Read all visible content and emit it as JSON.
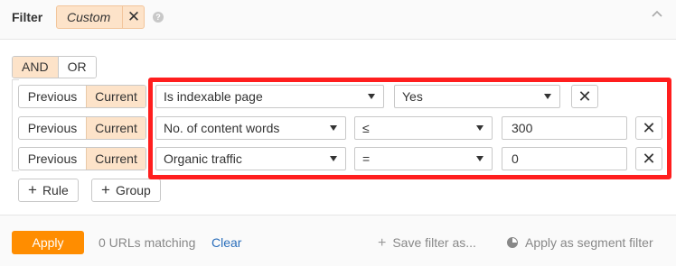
{
  "header": {
    "title": "Filter",
    "chip_label": "Custom",
    "chip_close": "✕",
    "help": "?",
    "collapse": "^"
  },
  "logic": {
    "and": "AND",
    "or": "OR",
    "selected": "AND"
  },
  "rows": [
    {
      "previous": "Previous",
      "current": "Current",
      "field": "Is indexable page",
      "operator": null,
      "value": "Yes",
      "value_type": "select",
      "remove": "✕"
    },
    {
      "previous": "Previous",
      "current": "Current",
      "field": "No. of content words",
      "operator": "≤",
      "value": "300",
      "value_type": "input",
      "remove": "✕"
    },
    {
      "previous": "Previous",
      "current": "Current",
      "field": "Organic traffic",
      "operator": "=",
      "value": "0",
      "value_type": "input",
      "remove": "✕"
    }
  ],
  "add": {
    "plus": "+",
    "rule": "Rule",
    "group": "Group"
  },
  "footer": {
    "apply": "Apply",
    "matching": "0 URLs matching",
    "clear": "Clear",
    "save_icon": "+",
    "save_filter": "Save filter as...",
    "segment": "Apply as segment filter"
  },
  "colors": {
    "accent": "#ff8d00",
    "chip_bg": "#fde3c9",
    "highlight": "#ff1e1e",
    "link": "#2a6ebb"
  }
}
